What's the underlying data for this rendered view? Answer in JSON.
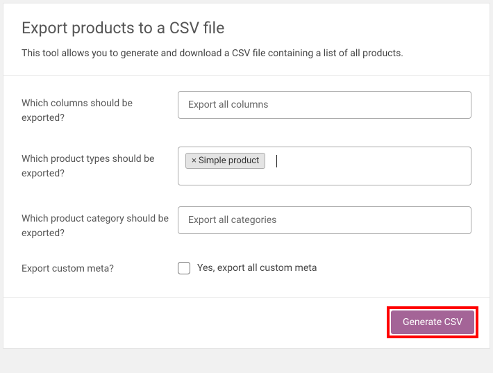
{
  "header": {
    "title": "Export products to a CSV file",
    "description": "This tool allows you to generate and download a CSV file containing a list of all products."
  },
  "fields": {
    "columns": {
      "label": "Which columns should be exported?",
      "placeholder": "Export all columns"
    },
    "productTypes": {
      "label": "Which product types should be exported?",
      "tags": [
        "Simple product"
      ]
    },
    "category": {
      "label": "Which product category should be exported?",
      "placeholder": "Export all categories"
    },
    "customMeta": {
      "label": "Export custom meta?",
      "checkboxLabel": "Yes, export all custom meta",
      "checked": false
    }
  },
  "footer": {
    "submitLabel": "Generate CSV"
  }
}
